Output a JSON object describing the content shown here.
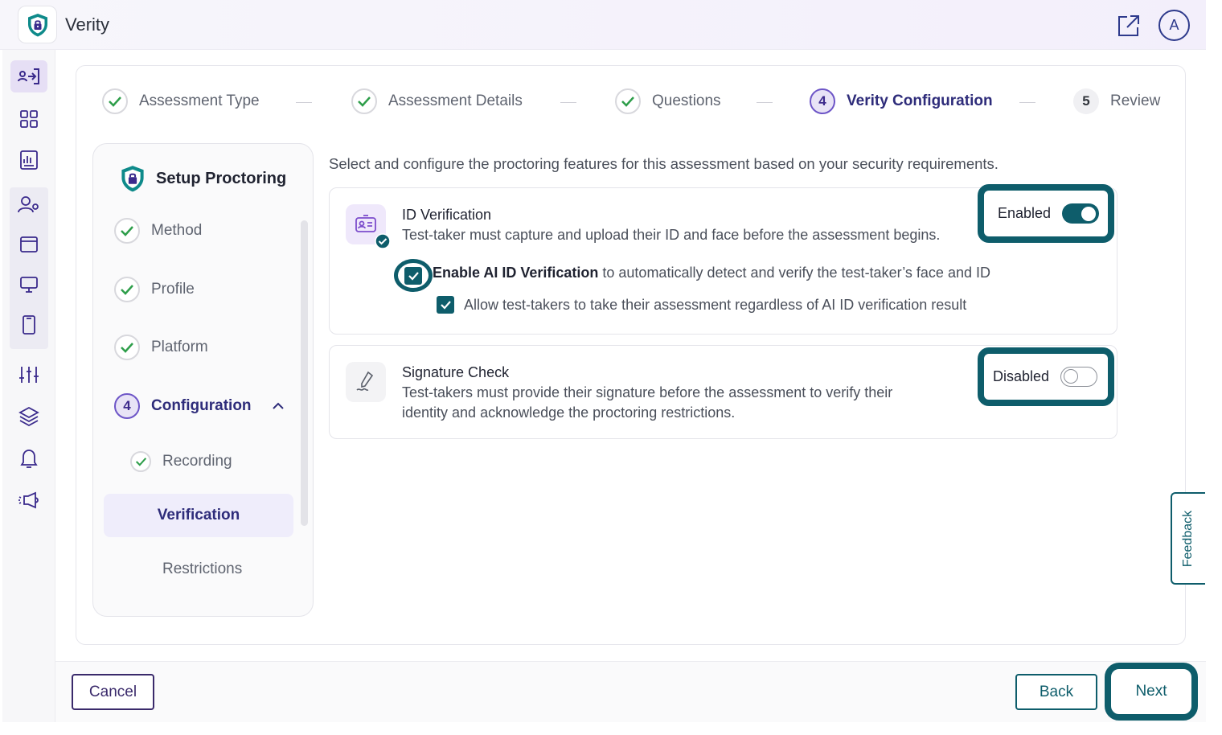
{
  "app": {
    "title": "Verity",
    "avatar_initial": "A",
    "accent": "#0e5d6b",
    "brand": "#6d55c7"
  },
  "sidebar": {
    "icons": [
      "login-arrow-icon",
      "grid-icon",
      "report-icon",
      "user-settings-icon",
      "window-icon",
      "monitor-icon",
      "mobile-icon",
      "sliders-icon",
      "layers-icon",
      "bell-icon",
      "megaphone-icon"
    ]
  },
  "stepper": {
    "steps": [
      {
        "label": "Assessment Type",
        "state": "done"
      },
      {
        "label": "Assessment Details",
        "state": "done"
      },
      {
        "label": "Questions",
        "state": "done"
      },
      {
        "label": "Verity Configuration",
        "number": "4",
        "state": "current"
      },
      {
        "label": "Review",
        "number": "5",
        "state": "todo"
      }
    ]
  },
  "setup": {
    "title": "Setup Proctoring",
    "items": [
      {
        "label": "Method"
      },
      {
        "label": "Profile"
      },
      {
        "label": "Platform"
      }
    ],
    "config": {
      "number": "4",
      "label": "Configuration"
    },
    "sub_items": {
      "recording": "Recording",
      "verification": "Verification",
      "restrictions": "Restrictions"
    }
  },
  "intro": "Select and configure the proctoring features for this assessment based on your security requirements.",
  "id_verification": {
    "title": "ID Verification",
    "description": "Test-taker must capture and upload their ID and face before the assessment begins.",
    "toggle_label": "Enabled",
    "enabled": true,
    "ai_bold": "Enable AI ID Verification",
    "ai_rest": " to automatically detect and verify the test-taker’s face and ID",
    "ai_checked": true,
    "allow_label": "Allow test-takers to take their assessment regardless of AI ID verification result",
    "allow_checked": true
  },
  "signature_check": {
    "title": "Signature Check",
    "description_line1": "Test-takers must provide their signature before the assessment to verify their",
    "description_line2": "identity and acknowledge the proctoring restrictions.",
    "toggle_label": "Disabled",
    "enabled": false
  },
  "feedback": "Feedback",
  "footer": {
    "cancel": "Cancel",
    "back": "Back",
    "next": "Next"
  }
}
